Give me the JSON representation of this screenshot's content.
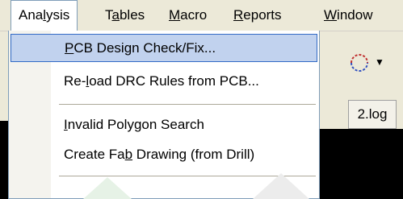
{
  "menubar": {
    "items": [
      {
        "pre": "Ana",
        "u": "l",
        "post": "ysis"
      },
      {
        "pre": "T",
        "u": "a",
        "post": "bles"
      },
      {
        "pre": "",
        "u": "M",
        "post": "acro"
      },
      {
        "pre": "",
        "u": "R",
        "post": "eports"
      },
      {
        "pre": "",
        "u": "W",
        "post": "indow"
      }
    ]
  },
  "dropdown": {
    "items": [
      {
        "pre": "",
        "u": "P",
        "post": "CB Design Check/Fix..."
      },
      {
        "pre": "Re-",
        "u": "l",
        "post": "oad DRC Rules from PCB..."
      },
      {
        "pre": "",
        "u": "I",
        "post": "nvalid Polygon Search"
      },
      {
        "pre": "Create Fa",
        "u": "b",
        "post": " Drawing (from Drill)"
      }
    ]
  },
  "background": {
    "log_tab": "2.log"
  },
  "colors": {
    "highlight": "#c1d2ee",
    "highlight_border": "#316ac5",
    "menu_bg": "#ece9d8"
  }
}
